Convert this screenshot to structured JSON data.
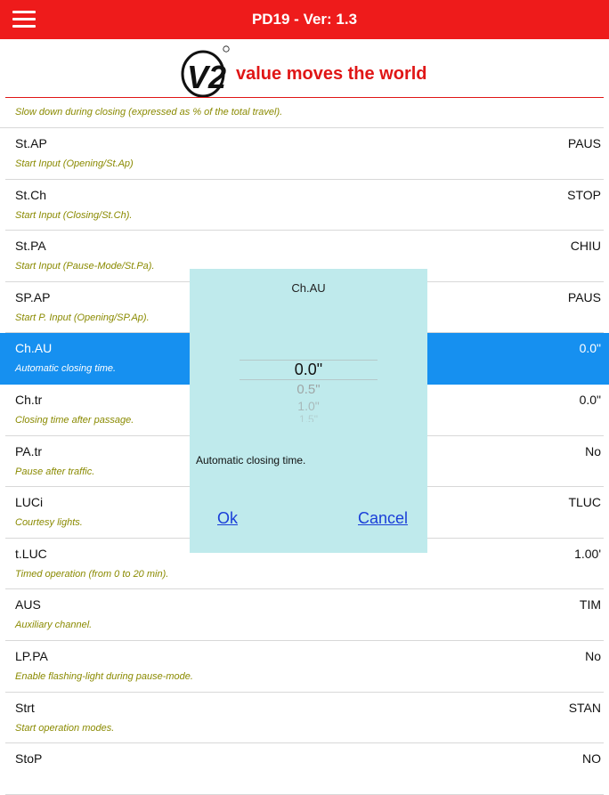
{
  "header": {
    "title": "PD19 - Ver: 1.3"
  },
  "brand": {
    "logo_text": "V2",
    "tagline": "value moves the world"
  },
  "first_description": "Slow down during closing (expressed as % of the total travel).",
  "rows": [
    {
      "name": "St.AP",
      "desc": "Start Input (Opening/St.Ap)",
      "value": "PAUS"
    },
    {
      "name": "St.Ch",
      "desc": "Start Input (Closing/St.Ch).",
      "value": "STOP"
    },
    {
      "name": "St.PA",
      "desc": "Start Input (Pause-Mode/St.Pa).",
      "value": "CHIU"
    },
    {
      "name": "SP.AP",
      "desc": "Start P. Input (Opening/SP.Ap).",
      "value": "PAUS"
    },
    {
      "name": "Ch.AU",
      "desc": "Automatic closing time.",
      "value": "0.0\""
    },
    {
      "name": "Ch.tr",
      "desc": "Closing time after passage.",
      "value": "0.0\""
    },
    {
      "name": "PA.tr",
      "desc": "Pause after traffic.",
      "value": "No"
    },
    {
      "name": "LUCi",
      "desc": "Courtesy lights.",
      "value": "TLUC"
    },
    {
      "name": "t.LUC",
      "desc": "Timed operation (from 0 to 20 min).",
      "value": "1.00'"
    },
    {
      "name": "AUS",
      "desc": "Auxiliary channel.",
      "value": "TIM"
    },
    {
      "name": "LP.PA",
      "desc": "Enable flashing-light during pause-mode.",
      "value": "No"
    },
    {
      "name": "Strt",
      "desc": "Start operation modes.",
      "value": "STAN"
    },
    {
      "name": "StoP",
      "desc": "",
      "value": "NO"
    }
  ],
  "selected_index": 4,
  "dialog": {
    "title": "Ch.AU",
    "picker_options": [
      "0.0\"",
      "0.5\"",
      "1.0\"",
      "1.5\""
    ],
    "picker_selected": "0.0\"",
    "description": "Automatic closing time.",
    "ok_label": "Ok",
    "cancel_label": "Cancel"
  },
  "colors": {
    "header_red": "#ee1b1b",
    "selected_blue": "#1690f0",
    "desc_olive": "#8a8a00",
    "dialog_bg": "#bfeaec",
    "link_blue": "#1a3ed8"
  }
}
